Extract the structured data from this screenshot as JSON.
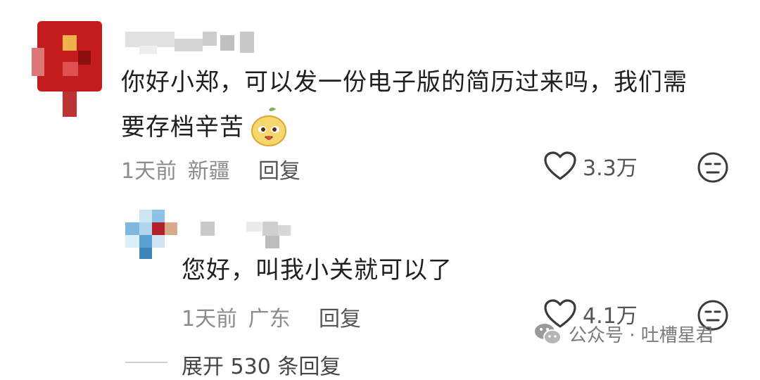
{
  "comments": [
    {
      "text_line1": "你好小郑，可以发一份电子版的简历过来吗，我们需",
      "text_line2": "要存档辛苦",
      "meta_time": "1天前",
      "meta_location": "新疆",
      "reply_label": "回复",
      "like_count": "3.3万",
      "sticker_icon": "yellow-sticker-icon"
    },
    {
      "text": "您好，叫我小关就可以了",
      "meta_time": "1天前",
      "meta_location": "广东",
      "reply_label": "回复",
      "like_count": "4.1万"
    }
  ],
  "expand_label": "展开 530 条回复",
  "watermark": "公众号 · 吐槽星君",
  "icons": {
    "like": "heart-icon",
    "dislike": "neutral-face-icon",
    "watermark": "wechat-icon"
  },
  "colors": {
    "text": "#1f1f1f",
    "meta": "#8c8c8c",
    "avatar1": "#c41c1c",
    "avatar2": "#7fb7de"
  }
}
